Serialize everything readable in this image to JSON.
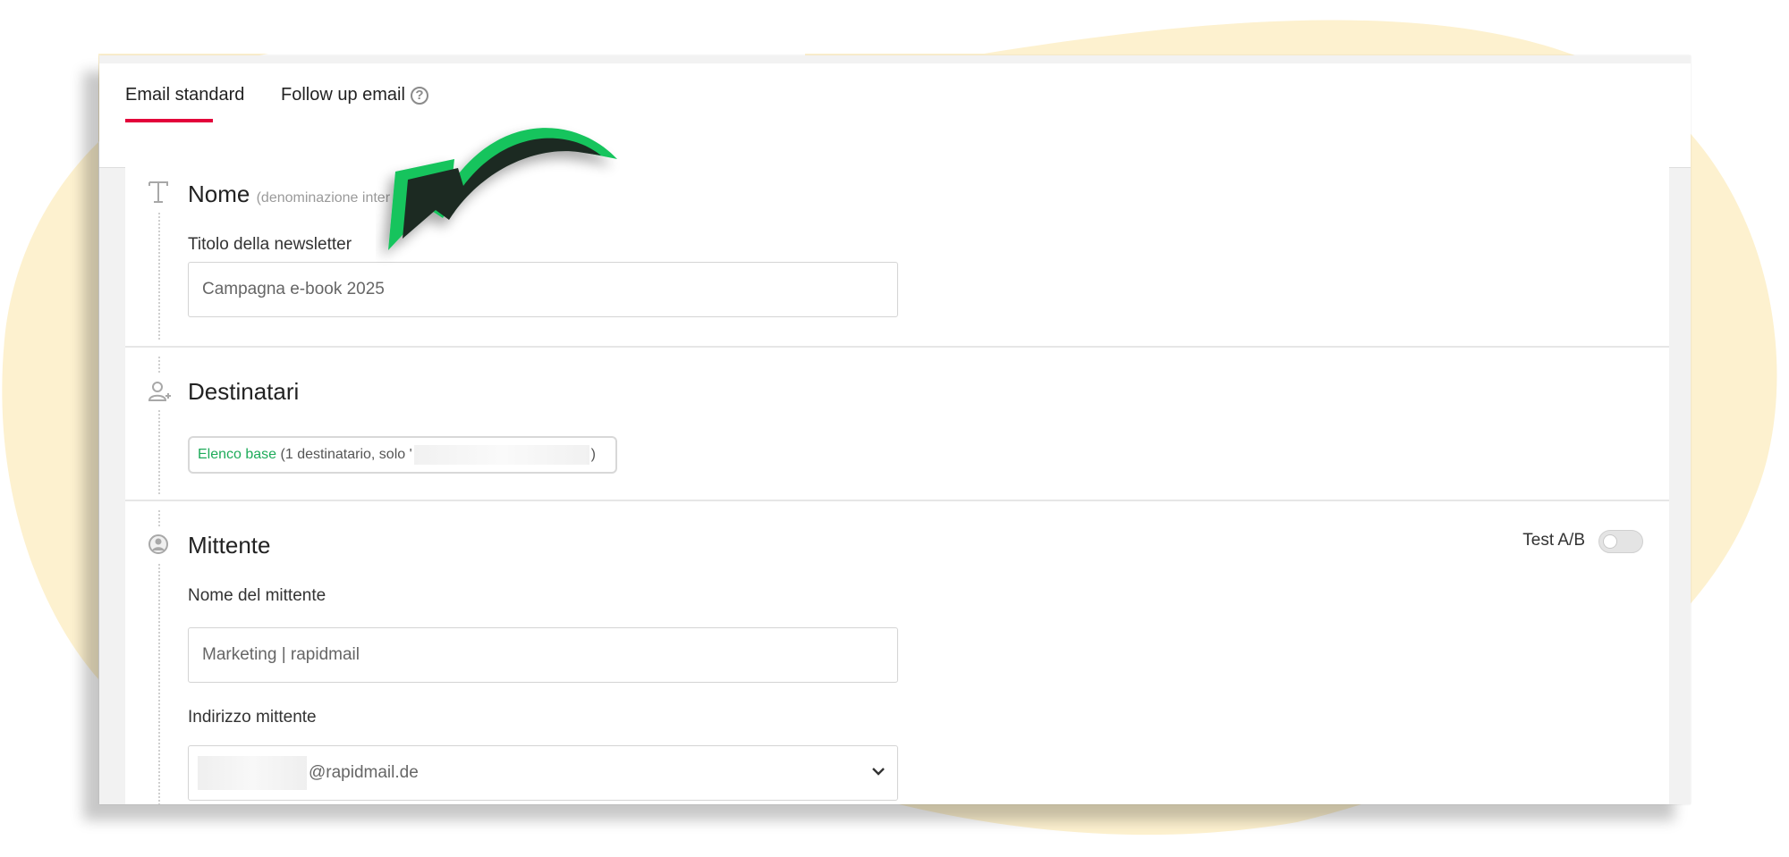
{
  "tabs": [
    {
      "label": "Email standard",
      "active": true
    },
    {
      "label": "Follow up email",
      "active": false
    }
  ],
  "accent_color": "#e3003a",
  "highlight_color": "#1eab5a",
  "sections": {
    "nome": {
      "title": "Nome",
      "subtitle": "(denominazione inter",
      "icon": "text-icon",
      "field_label": "Titolo della newsletter",
      "field_value": "Campagna e-book 2025"
    },
    "destinatari": {
      "title": "Destinatari",
      "icon": "add-user-icon",
      "chip_list": "Elenco base",
      "chip_text_before": "(1 destinatario, solo '",
      "chip_text_after": ")"
    },
    "mittente": {
      "title": "Mittente",
      "icon": "user-circle-icon",
      "toggle_label": "Test A/B",
      "toggle_on": false,
      "sender_name_label": "Nome del mittente",
      "sender_name_value": "Marketing | rapidmail",
      "sender_address_label": "Indirizzo mittente",
      "sender_address_domain": "@rapidmail.de"
    }
  }
}
